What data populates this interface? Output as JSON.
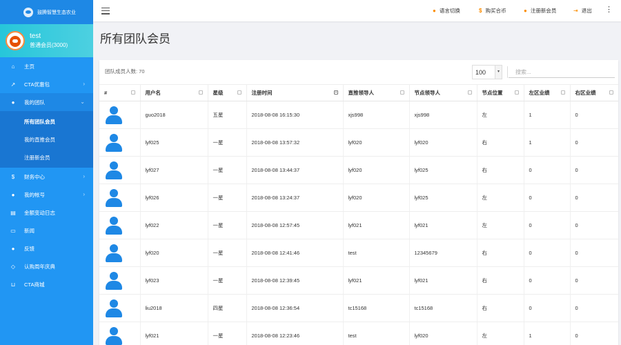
{
  "sidebar": {
    "brand": "鼓腾智慧生态农业",
    "user": {
      "name": "test",
      "level": "普通会员(3000)"
    },
    "nav": [
      {
        "icon": "home-icon",
        "glyph": "⌂",
        "label": "主页",
        "chevron": false
      },
      {
        "icon": "chart-icon",
        "glyph": "↗",
        "label": "CTA优惠包",
        "chevron": true
      },
      {
        "icon": "team-icon",
        "glyph": "●",
        "label": "我的团队",
        "chevron": true,
        "expanded": true,
        "children": [
          {
            "label": "所有团队会员",
            "current": true
          },
          {
            "label": "我的直推会员",
            "current": false
          },
          {
            "label": "注册新会员",
            "current": false
          }
        ]
      },
      {
        "icon": "dollar-icon",
        "glyph": "$",
        "label": "财务中心",
        "chevron": true
      },
      {
        "icon": "user-icon",
        "glyph": "●",
        "label": "我的帐号",
        "chevron": true
      },
      {
        "icon": "document-icon",
        "glyph": "▤",
        "label": "金额变动日志",
        "chevron": false
      },
      {
        "icon": "news-icon",
        "glyph": "▭",
        "label": "新闻",
        "chevron": false
      },
      {
        "icon": "chat-icon",
        "glyph": "●",
        "label": "反馈",
        "chevron": false
      },
      {
        "icon": "diamond-icon",
        "glyph": "◇",
        "label": "认购周年庆典",
        "chevron": false
      },
      {
        "icon": "cart-icon",
        "glyph": "⊔",
        "label": "CTA商城",
        "chevron": false
      }
    ]
  },
  "topbar": {
    "language": "语言切换",
    "buy": "购买合币",
    "register": "注册新会员",
    "logout": "退出"
  },
  "page": {
    "title": "所有团队会员"
  },
  "toolbar": {
    "team_count": "团队成员人数: 70",
    "page_size": "100",
    "search_placeholder": "搜索..."
  },
  "table": {
    "columns": [
      "#",
      "用户名",
      "星级",
      "注册时间",
      "直推领导人",
      "节点领导人",
      "节点位置",
      "左区业绩",
      "右区业绩"
    ],
    "rows": [
      [
        "guo2018",
        "五星",
        "2018-08-08 16:15:30",
        "xjs998",
        "xjs998",
        "左",
        "1",
        "0"
      ],
      [
        "lyf025",
        "一星",
        "2018-08-08 13:57:32",
        "lyf020",
        "lyf020",
        "右",
        "1",
        "0"
      ],
      [
        "lyf027",
        "一星",
        "2018-08-08 13:44:37",
        "lyf020",
        "lyf025",
        "右",
        "0",
        "0"
      ],
      [
        "lyf026",
        "一星",
        "2018-08-08 13:24:37",
        "lyf020",
        "lyf025",
        "左",
        "0",
        "0"
      ],
      [
        "lyf022",
        "一星",
        "2018-08-08 12:57:45",
        "lyf021",
        "lyf021",
        "左",
        "0",
        "0"
      ],
      [
        "lyf020",
        "一星",
        "2018-08-08 12:41:46",
        "test",
        "12345679",
        "右",
        "0",
        "0"
      ],
      [
        "lyf023",
        "一星",
        "2018-08-08 12:39:45",
        "lyf021",
        "lyf021",
        "右",
        "0",
        "0"
      ],
      [
        "liu2018",
        "四星",
        "2018-08-08 12:36:54",
        "tc15168",
        "tc15168",
        "右",
        "0",
        "0"
      ],
      [
        "lyf021",
        "一星",
        "2018-08-08 12:23:46",
        "test",
        "lyf020",
        "左",
        "1",
        "0"
      ]
    ]
  }
}
